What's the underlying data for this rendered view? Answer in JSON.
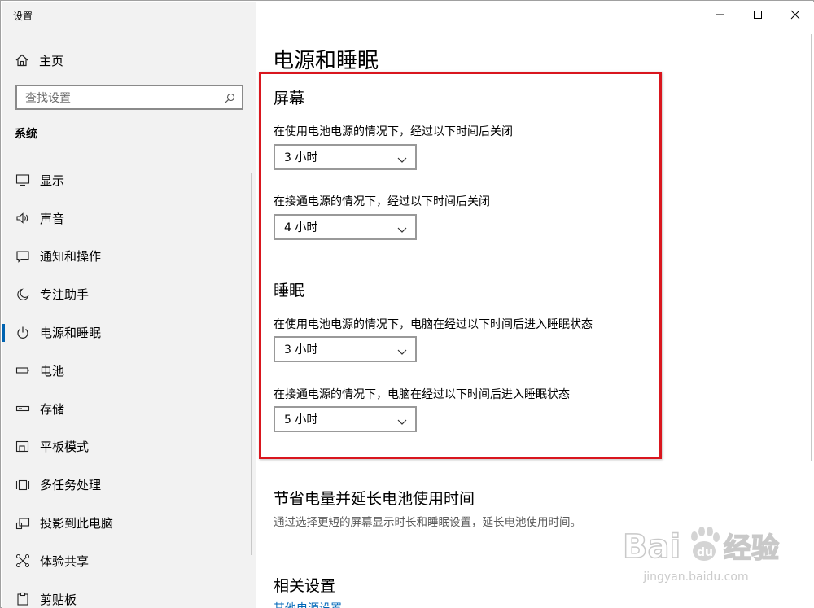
{
  "window": {
    "app_title": "设置",
    "controls": [
      "minimize-icon",
      "maximize-icon",
      "close-icon"
    ]
  },
  "sidebar": {
    "home_label": "主页",
    "search_placeholder": "查找设置",
    "section_label": "系统",
    "items": [
      {
        "label": "显示",
        "icon": "monitor-icon"
      },
      {
        "label": "声音",
        "icon": "speaker-icon"
      },
      {
        "label": "通知和操作",
        "icon": "message-icon"
      },
      {
        "label": "专注助手",
        "icon": "moon-icon"
      },
      {
        "label": "电源和睡眠",
        "icon": "power-icon",
        "selected": true
      },
      {
        "label": "电池",
        "icon": "battery-icon"
      },
      {
        "label": "存储",
        "icon": "storage-icon"
      },
      {
        "label": "平板模式",
        "icon": "tablet-icon"
      },
      {
        "label": "多任务处理",
        "icon": "multitask-icon"
      },
      {
        "label": "投影到此电脑",
        "icon": "project-icon"
      },
      {
        "label": "体验共享",
        "icon": "share-icon"
      },
      {
        "label": "剪贴板",
        "icon": "clipboard-icon"
      }
    ]
  },
  "main": {
    "title": "电源和睡眠",
    "screen": {
      "heading": "屏幕",
      "battery_label": "在使用电池电源的情况下，经过以下时间后关闭",
      "battery_value": "3 小时",
      "plugged_label": "在接通电源的情况下，经过以下时间后关闭",
      "plugged_value": "4 小时"
    },
    "sleep": {
      "heading": "睡眠",
      "battery_label": "在使用电池电源的情况下，电脑在经过以下时间后进入睡眠状态",
      "battery_value": "3 小时",
      "plugged_label": "在接通电源的情况下，电脑在经过以下时间后进入睡眠状态",
      "plugged_value": "5 小时"
    },
    "save": {
      "heading": "节省电量并延长电池使用时间",
      "description": "通过选择更短的屏幕显示时长和睡眠设置，延长电池使用时间。"
    },
    "related": {
      "heading": "相关设置",
      "link": "其他电源设置"
    }
  },
  "watermark": {
    "brand": "Baidu经验",
    "url": "jingyan.baidu.com"
  },
  "colors": {
    "accent": "#0063b1",
    "highlight_box": "#d9161e",
    "sidebar_bg": "#f2f2f2",
    "link": "#0067b8"
  }
}
